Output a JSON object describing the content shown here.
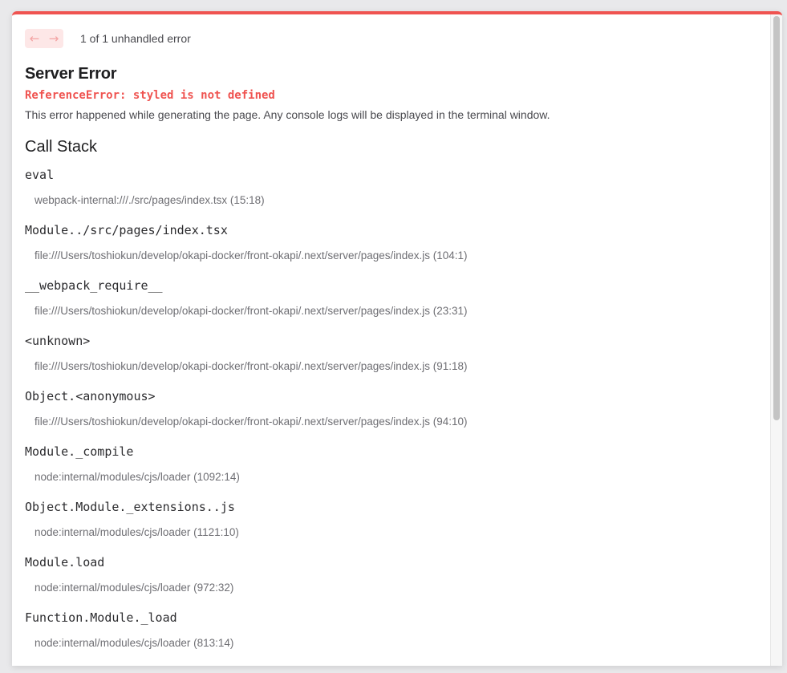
{
  "nav": {
    "prev_icon": "←",
    "next_icon": "→",
    "counter_text": "1 of 1 unhandled error"
  },
  "error": {
    "title": "Server Error",
    "message": "ReferenceError: styled is not defined",
    "description": "This error happened while generating the page. Any console logs will be displayed in the terminal window."
  },
  "call_stack": {
    "title": "Call Stack",
    "frames": [
      {
        "fn": "eval",
        "loc": "webpack-internal:///./src/pages/index.tsx (15:18)"
      },
      {
        "fn": "Module../src/pages/index.tsx",
        "loc": "file:///Users/toshiokun/develop/okapi-docker/front-okapi/.next/server/pages/index.js (104:1)"
      },
      {
        "fn": "__webpack_require__",
        "loc": "file:///Users/toshiokun/develop/okapi-docker/front-okapi/.next/server/pages/index.js (23:31)"
      },
      {
        "fn": "<unknown>",
        "loc": "file:///Users/toshiokun/develop/okapi-docker/front-okapi/.next/server/pages/index.js (91:18)"
      },
      {
        "fn": "Object.<anonymous>",
        "loc": "file:///Users/toshiokun/develop/okapi-docker/front-okapi/.next/server/pages/index.js (94:10)"
      },
      {
        "fn": "Module._compile",
        "loc": "node:internal/modules/cjs/loader (1092:14)"
      },
      {
        "fn": "Object.Module._extensions..js",
        "loc": "node:internal/modules/cjs/loader (1121:10)"
      },
      {
        "fn": "Module.load",
        "loc": "node:internal/modules/cjs/loader (972:32)"
      },
      {
        "fn": "Function.Module._load",
        "loc": "node:internal/modules/cjs/loader (813:14)"
      }
    ]
  },
  "colors": {
    "accent": "#ef5350",
    "nav_bg": "#fde7e7",
    "nav_icon": "#f4a4a4"
  }
}
